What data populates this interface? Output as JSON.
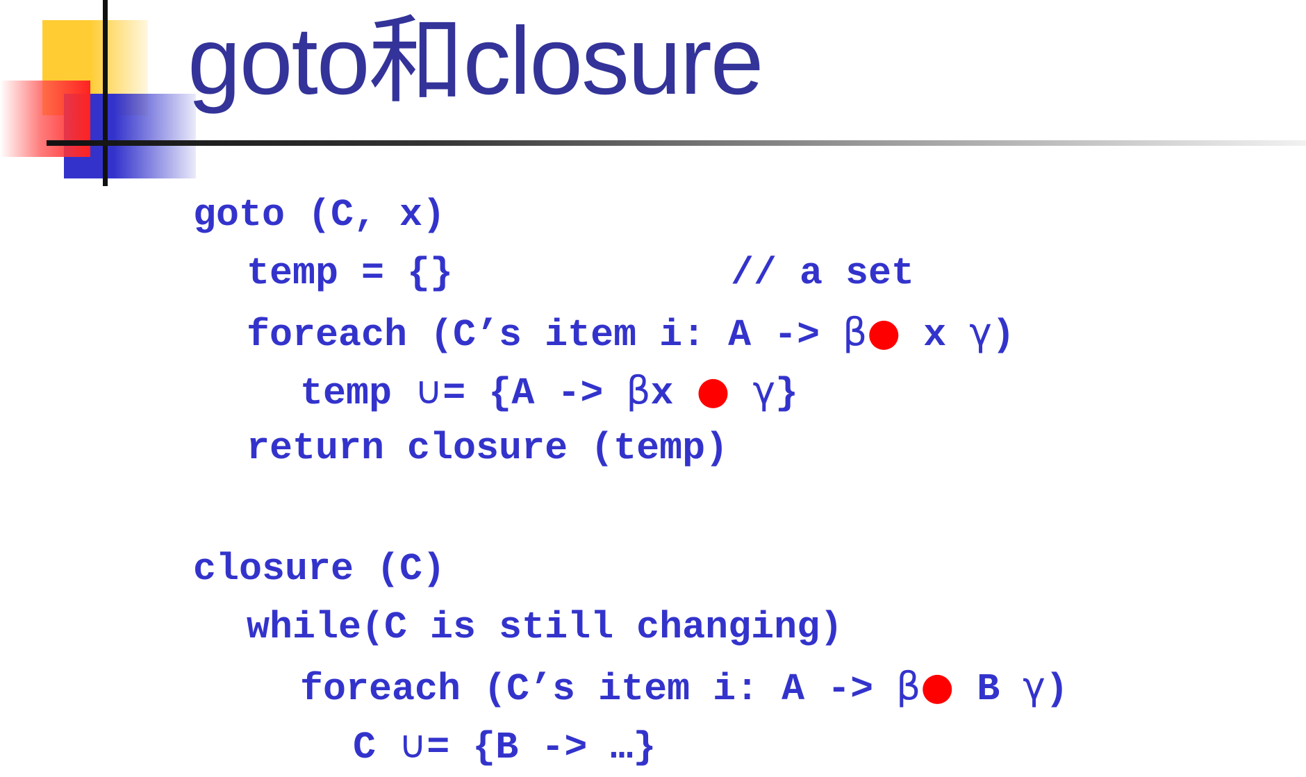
{
  "slide": {
    "title": "goto和closure",
    "goto_block": {
      "header": "goto (C, x)",
      "l1": "temp = {}",
      "l1_comment": "// a set",
      "l2_pre": "foreach (C’s item i: A -> ",
      "l2_beta": "β",
      "l2_dot": "●",
      "l2_x": " x ",
      "l2_gamma": "γ",
      "l2_close": ")",
      "l3_pre": "temp ",
      "l3_union": "∪",
      "l3_mid": "= {A -> ",
      "l3_beta": "β",
      "l3_x": "x ",
      "l3_dot": "●",
      "l3_sp": " ",
      "l3_gamma": "γ",
      "l3_close": "}",
      "l4": "return closure (temp)"
    },
    "closure_block": {
      "header": "closure (C)",
      "l1": "while(C is still changing)",
      "l2_pre": "foreach (C’s item i: A -> ",
      "l2_beta": "β",
      "l2_dot": "●",
      "l2_b": " B ",
      "l2_gamma": "γ",
      "l2_close": ")",
      "l3_pre": "C ",
      "l3_union": "∪",
      "l3_rest": "= {B -> …}"
    }
  },
  "colors": {
    "title": "#333399",
    "code": "#3333cc",
    "dot": "#ff0000"
  }
}
